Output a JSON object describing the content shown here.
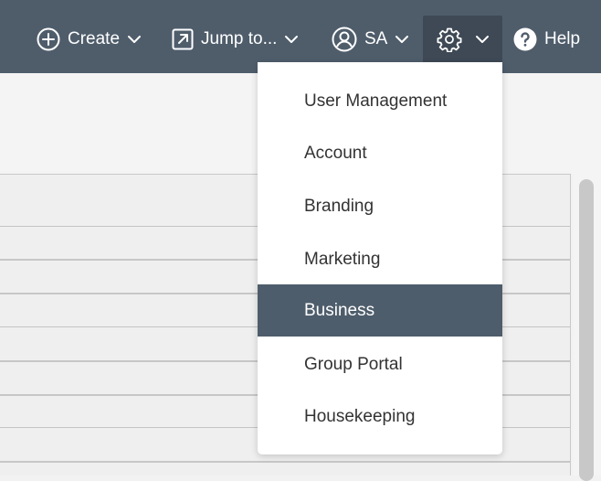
{
  "header": {
    "create_label": "Create",
    "jump_label": "Jump to...",
    "user_label": "SA",
    "help_label": "Help",
    "icons": {
      "create": "plus-circle-icon",
      "jump": "external-link-square-icon",
      "user": "user-circle-icon",
      "settings": "gear-icon",
      "help": "question-circle-icon",
      "chevron": "chevron-down-icon"
    }
  },
  "settings_menu": {
    "items": [
      {
        "label": "User Management"
      },
      {
        "label": "Account"
      },
      {
        "label": "Branding"
      },
      {
        "label": "Marketing"
      },
      {
        "label": "Business"
      },
      {
        "label": "Group Portal"
      },
      {
        "label": "Housekeeping"
      }
    ],
    "active_item": "Business"
  },
  "colors": {
    "topbar": "#4f5d6b",
    "settings_active": "#3e4955",
    "menu_active": "#4e5d6b",
    "menu_text": "#333333"
  }
}
